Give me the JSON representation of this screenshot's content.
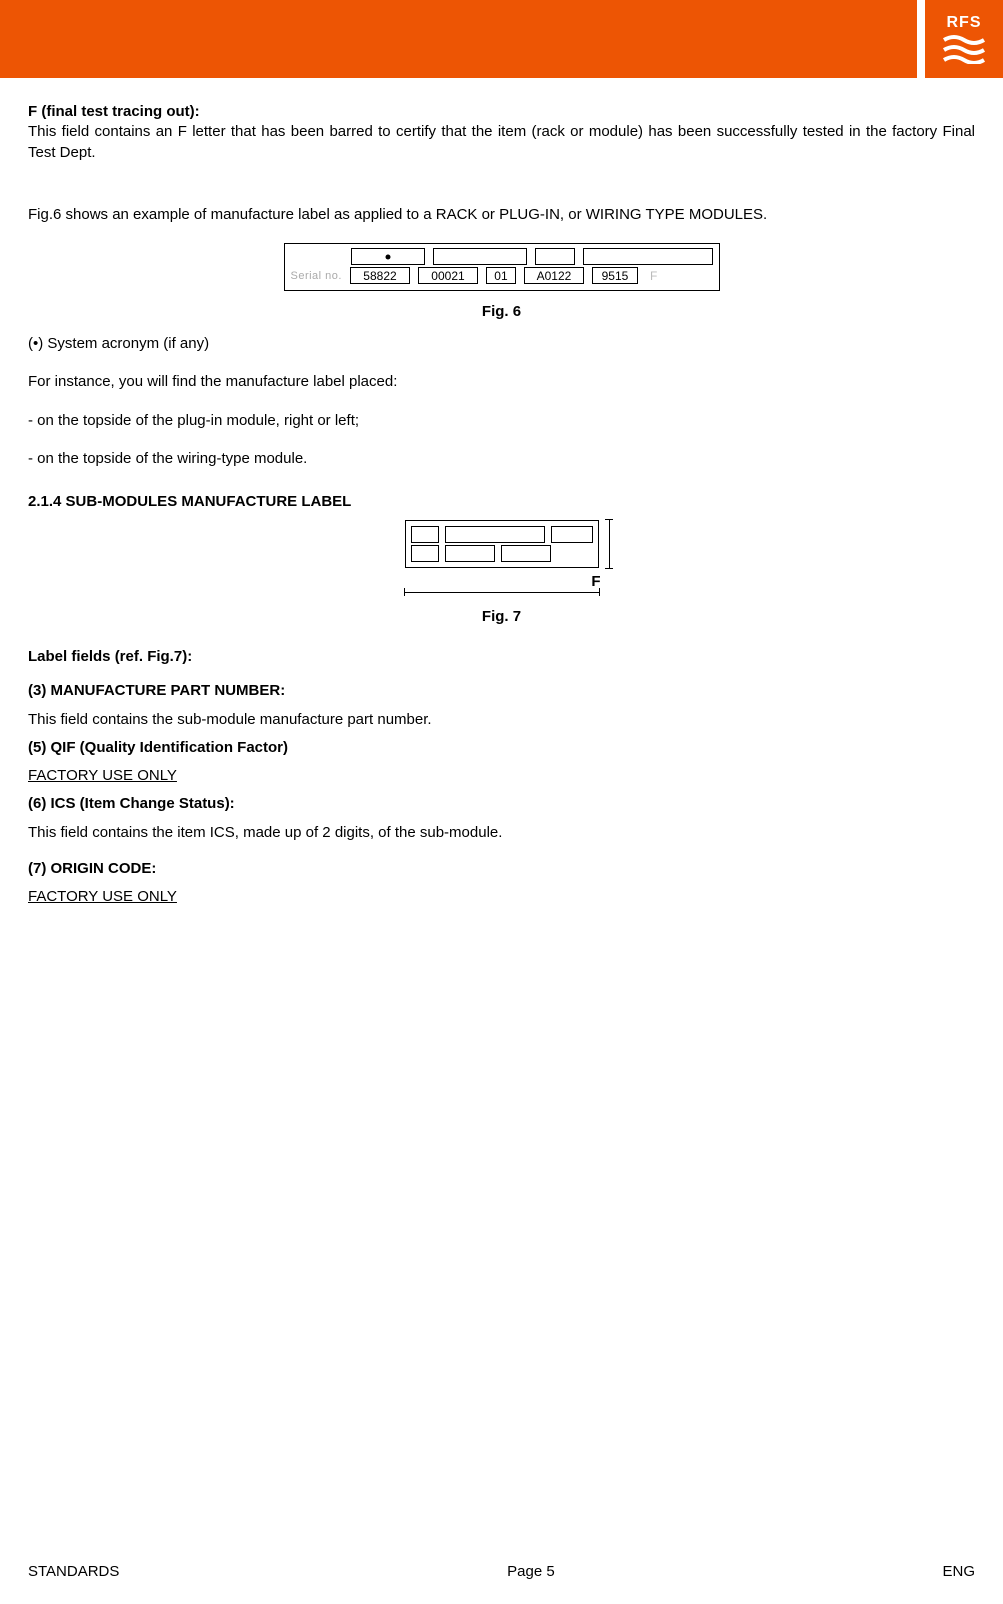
{
  "logo": {
    "text": "RFS"
  },
  "body": {
    "f_heading": "F (final test tracing out):",
    "f_text": "This field contains an F letter that has been barred to certify that the item (rack or module) has been successfully tested in the factory Final Test Dept.",
    "fig6_intro": "Fig.6 shows an example of manufacture label as applied to a RACK or PLUG-IN, or WIRING TYPE MODULES.",
    "fig6": {
      "serial_label": "Serial no.",
      "v1": "58822",
      "v2": "00021",
      "v3": "01",
      "v4": "A0122",
      "v5": "9515",
      "f": "F"
    },
    "fig6_caption": "Fig. 6",
    "bullet_note": "(•) System acronym (if any)",
    "placed_intro": "For instance, you will find the manufacture label placed:",
    "placed_1": "- on the topside of the plug-in module, right or left;",
    "placed_2": "- on the topside of the wiring-type module.",
    "section_214": "2.1.4 SUB-MODULES MANUFACTURE LABEL",
    "fig7_f": "F",
    "fig7_caption": "Fig. 7",
    "label_fields_heading": "Label fields (ref. Fig.7):",
    "f3_h": "(3) MANUFACTURE PART NUMBER:",
    "f3_t": "This field contains the sub-module manufacture part number.",
    "f5_h": "(5) QIF (Quality Identification Factor)",
    "f5_t": "FACTORY USE ONLY",
    "f6_h": "(6) ICS (Item Change Status):",
    "f6_t": "This field contains the item ICS, made up of 2 digits, of the sub-module.",
    "f7_h": "(7) ORIGIN CODE:",
    "f7_t": "FACTORY USE ONLY"
  },
  "footer": {
    "left": "STANDARDS",
    "center": "Page 5",
    "right": "ENG"
  }
}
